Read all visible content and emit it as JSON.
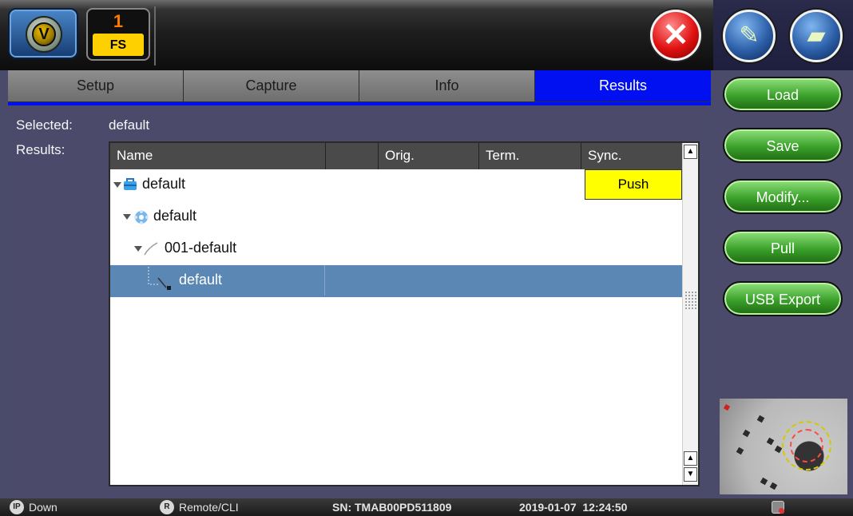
{
  "topbar": {
    "badge_number": "1",
    "badge_label": "FS",
    "logo_letter": "V"
  },
  "tabs": [
    {
      "label": "Setup",
      "active": false
    },
    {
      "label": "Capture",
      "active": false
    },
    {
      "label": "Info",
      "active": false
    },
    {
      "label": "Results",
      "active": true
    }
  ],
  "main": {
    "selected_label": "Selected:",
    "selected_value": "default",
    "results_label": "Results:"
  },
  "table": {
    "columns": [
      "Name",
      "",
      "Orig.",
      "Term.",
      "Sync."
    ],
    "rows": [
      {
        "name": "default",
        "level": 0,
        "icon": "briefcase-icon",
        "sync": "Push"
      },
      {
        "name": "default",
        "level": 1,
        "icon": "gear-icon",
        "sync": ""
      },
      {
        "name": "001-default",
        "level": 2,
        "icon": "fiber-icon",
        "sync": ""
      },
      {
        "name": "default",
        "level": 3,
        "icon": "tree-branch-icon",
        "sync": "",
        "selected": true
      }
    ]
  },
  "sidebar": {
    "buttons": [
      "Load",
      "Save",
      "Modify...",
      "Pull",
      "USB Export"
    ]
  },
  "statusbar": {
    "ip_badge": "IP",
    "ip_status": "Down",
    "r_badge": "R",
    "remote_label": "Remote/CLI",
    "serial": "SN: TMAB00PD511809",
    "datetime": "2019-01-07  12:24:50"
  },
  "colors": {
    "active_tab": "#0010f0",
    "push_highlight": "#ffff00",
    "selected_row": "#5b87b5",
    "button_green": "#3aa12a"
  }
}
